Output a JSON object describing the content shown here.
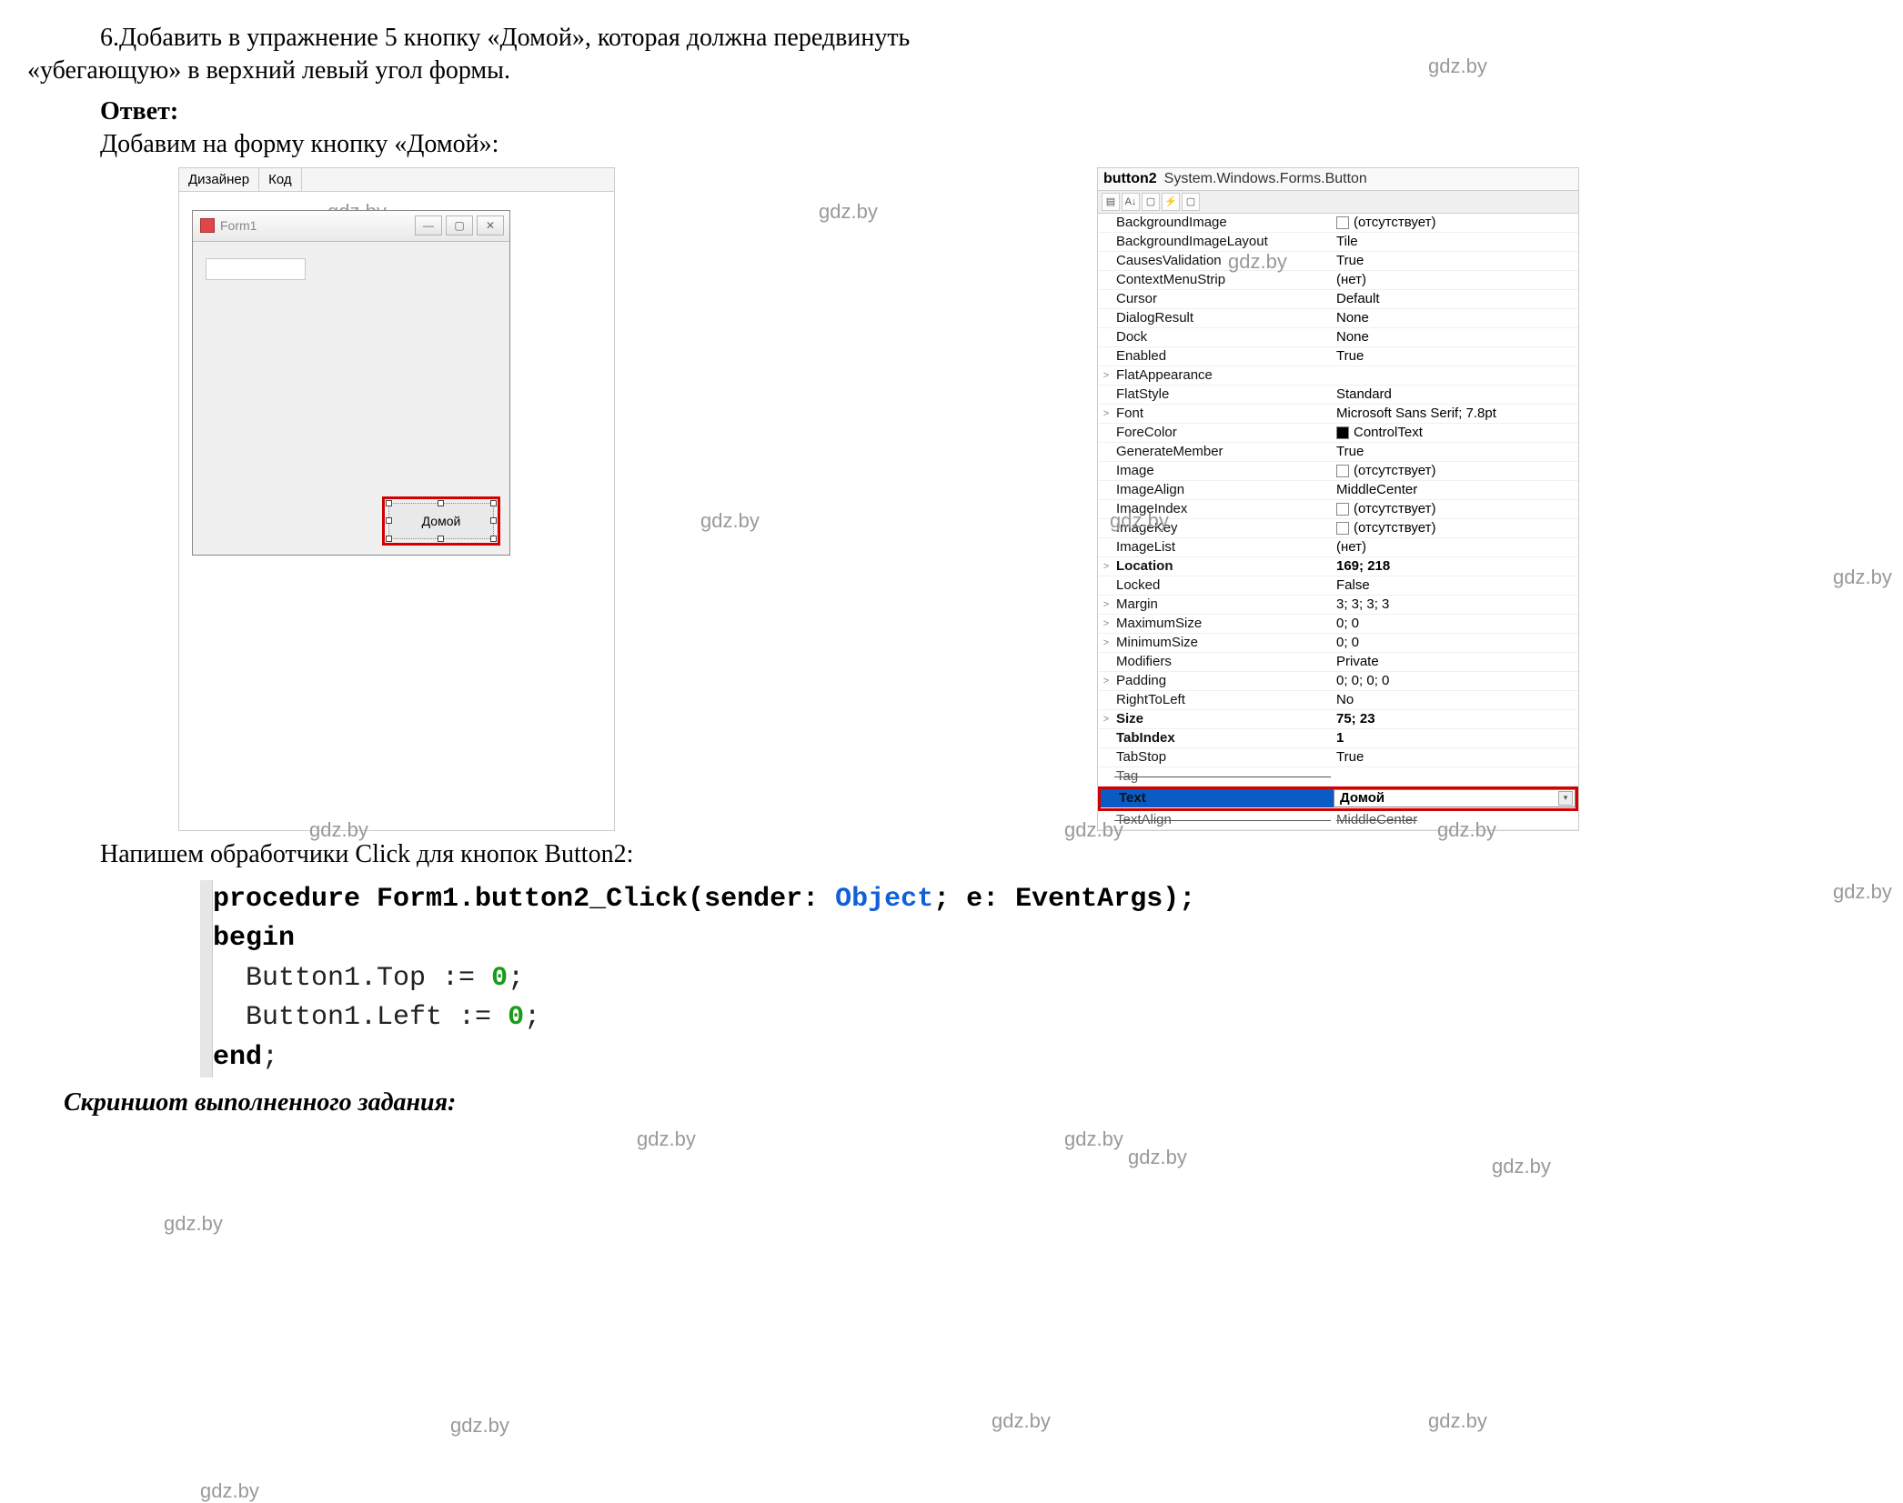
{
  "task": {
    "line1": "6.Добавить в упражнение 5 кнопку «Домой», которая должна передвинуть",
    "line2": "«убегающую» в верхний левый угол формы."
  },
  "answer_label": "Ответ:",
  "add_button_line": "Добавим на форму кнопку «Домой»:",
  "designer": {
    "tab1": "Дизайнер",
    "tab2": "Код",
    "form_title": "Form1",
    "button2_label": "Домой"
  },
  "properties": {
    "header_name": "button2",
    "header_class": "System.Windows.Forms.Button",
    "rows": [
      {
        "name": "BackgroundImage",
        "value": "(отсутствует)",
        "swatch": "empty"
      },
      {
        "name": "BackgroundImageLayout",
        "value": "Tile"
      },
      {
        "name": "CausesValidation",
        "value": "True"
      },
      {
        "name": "ContextMenuStrip",
        "value": "(нет)"
      },
      {
        "name": "Cursor",
        "value": "Default"
      },
      {
        "name": "DialogResult",
        "value": "None"
      },
      {
        "name": "Dock",
        "value": "None"
      },
      {
        "name": "Enabled",
        "value": "True"
      },
      {
        "name": "FlatAppearance",
        "value": "",
        "expand": ">"
      },
      {
        "name": "FlatStyle",
        "value": "Standard"
      },
      {
        "name": "Font",
        "value": "Microsoft Sans Serif; 7.8pt",
        "expand": ">"
      },
      {
        "name": "ForeColor",
        "value": "ControlText",
        "swatch": "black"
      },
      {
        "name": "GenerateMember",
        "value": "True"
      },
      {
        "name": "Image",
        "value": "(отсутствует)",
        "swatch": "empty"
      },
      {
        "name": "ImageAlign",
        "value": "MiddleCenter"
      },
      {
        "name": "ImageIndex",
        "value": "(отсутствует)",
        "swatch": "empty"
      },
      {
        "name": "ImageKey",
        "value": "(отсутствует)",
        "swatch": "empty"
      },
      {
        "name": "ImageList",
        "value": "(нет)"
      },
      {
        "name": "Location",
        "value": "169; 218",
        "bold": true,
        "expand": ">"
      },
      {
        "name": "Locked",
        "value": "False"
      },
      {
        "name": "Margin",
        "value": "3; 3; 3; 3",
        "expand": ">"
      },
      {
        "name": "MaximumSize",
        "value": "0; 0",
        "expand": ">"
      },
      {
        "name": "MinimumSize",
        "value": "0; 0",
        "expand": ">"
      },
      {
        "name": "Modifiers",
        "value": "Private"
      },
      {
        "name": "Padding",
        "value": "0; 0; 0; 0",
        "expand": ">"
      },
      {
        "name": "RightToLeft",
        "value": "No"
      },
      {
        "name": "Size",
        "value": "75; 23",
        "bold": true,
        "expand": ">"
      },
      {
        "name": "TabIndex",
        "value": "1",
        "bold": true
      },
      {
        "name": "TabStop",
        "value": "True"
      },
      {
        "name": "Tag",
        "value": "",
        "struck": true
      }
    ],
    "selected": {
      "name": "Text",
      "value": "Домой"
    },
    "after_selected": {
      "name": "TextAlign",
      "value": "MiddleCenter",
      "struck": true
    }
  },
  "click_handler_line": "Напишем обработчики Click для кнопок Button2:",
  "code": {
    "l1_a": "procedure",
    "l1_b": " Form1.button2_Click(sender: ",
    "l1_c": "Object",
    "l1_d": "; e: EventArgs);",
    "l2": "begin",
    "l3_a": "  Button1.Top := ",
    "l3_b": "0",
    "l3_c": ";",
    "l4_a": "  Button1.Left := ",
    "l4_b": "0",
    "l4_c": ";",
    "l5": "end",
    "l5b": ";"
  },
  "screenshot_line": "Скриншот выполненного задания:",
  "watermark": "gdz.by"
}
